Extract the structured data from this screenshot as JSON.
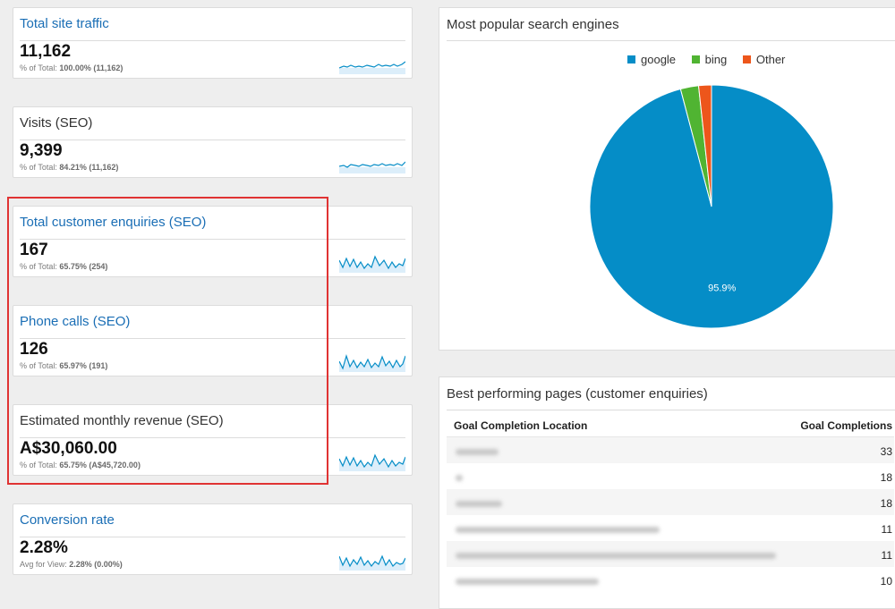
{
  "metrics": [
    {
      "title": "Total site traffic",
      "value": "11,162",
      "sub_prefix": "% of Total:",
      "sub_bold": "100.00% (11,162)"
    },
    {
      "title": "Visits (SEO)",
      "value": "9,399",
      "sub_prefix": "% of Total:",
      "sub_bold": "84.21% (11,162)"
    },
    {
      "title": "Total customer enquiries (SEO)",
      "value": "167",
      "sub_prefix": "% of Total:",
      "sub_bold": "65.75% (254)"
    },
    {
      "title": "Phone calls (SEO)",
      "value": "126",
      "sub_prefix": "% of Total:",
      "sub_bold": "65.97% (191)"
    },
    {
      "title": "Estimated monthly revenue (SEO)",
      "value": "A$30,060.00",
      "sub_prefix": "% of Total:",
      "sub_bold": "65.75% (A$45,720.00)"
    },
    {
      "title": "Conversion rate",
      "value": "2.28%",
      "sub_prefix": "Avg for View:",
      "sub_bold": "2.28% (0.00%)"
    }
  ],
  "search_engines": {
    "title": "Most popular search engines",
    "legend": [
      {
        "label": "google",
        "color": "#058dc7"
      },
      {
        "label": "bing",
        "color": "#50b432"
      },
      {
        "label": "Other",
        "color": "#ed561b"
      }
    ],
    "chart_data": {
      "type": "pie",
      "labels": [
        "google",
        "bing",
        "Other"
      ],
      "values": [
        95.9,
        2.4,
        1.7
      ],
      "data_labels": [
        "95.9%"
      ]
    }
  },
  "best_pages": {
    "title": "Best performing pages (customer enquiries)",
    "col1": "Goal Completion Location",
    "col2": "Goal Completions",
    "rows": [
      {
        "count": "33"
      },
      {
        "count": "18"
      },
      {
        "count": "18"
      },
      {
        "count": "11"
      },
      {
        "count": "11"
      },
      {
        "count": "10"
      }
    ]
  },
  "colors": {
    "link": "#1a6eb5",
    "highlight": "#e03333",
    "sparkline": "#058dc7"
  }
}
